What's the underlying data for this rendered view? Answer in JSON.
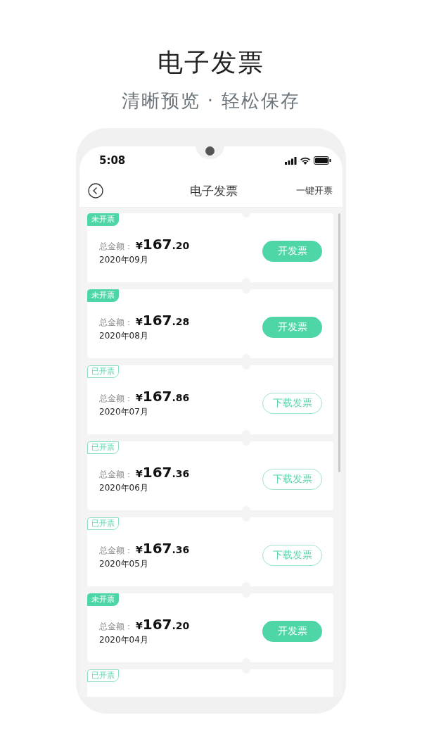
{
  "headline": "电子发票",
  "subtitle": "清晰预览 · 轻松保存",
  "status_bar": {
    "time": "5:08"
  },
  "nav": {
    "title": "电子发票",
    "action": "一键开票"
  },
  "invoices": [
    {
      "tag": "未开票",
      "issued": false,
      "label": "总金额：",
      "currency": "¥",
      "amount": "167",
      "decimals": ".20",
      "date": "2020年09月",
      "button": "开发票"
    },
    {
      "tag": "未开票",
      "issued": false,
      "label": "总金额：",
      "currency": "¥",
      "amount": "167",
      "decimals": ".28",
      "date": "2020年08月",
      "button": "开发票"
    },
    {
      "tag": "已开票",
      "issued": true,
      "label": "总金额：",
      "currency": "¥",
      "amount": "167",
      "decimals": ".86",
      "date": "2020年07月",
      "button": "下载发票"
    },
    {
      "tag": "已开票",
      "issued": true,
      "label": "总金额：",
      "currency": "¥",
      "amount": "167",
      "decimals": ".36",
      "date": "2020年06月",
      "button": "下载发票"
    },
    {
      "tag": "已开票",
      "issued": true,
      "label": "总金额：",
      "currency": "¥",
      "amount": "167",
      "decimals": ".36",
      "date": "2020年05月",
      "button": "下载发票"
    },
    {
      "tag": "未开票",
      "issued": false,
      "label": "总金额：",
      "currency": "¥",
      "amount": "167",
      "decimals": ".20",
      "date": "2020年04月",
      "button": "开发票"
    },
    {
      "tag": "已开票",
      "issued": true
    }
  ]
}
